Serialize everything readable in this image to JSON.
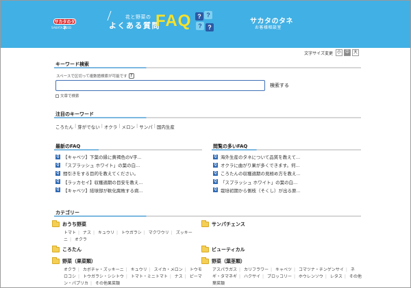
{
  "header": {
    "logo_text": "サカタのタネ",
    "logo_sub": "SAKATA SEED",
    "small_title": "花と野菜の",
    "main_title": "よくある質問",
    "faq": "FAQ",
    "q": "?",
    "brand": "サカタのタネ",
    "brand_sub": "お客様相談室",
    "colors": {
      "header_bg": "#41b0e4",
      "faq": "#f7e22a",
      "accent": "#2f6ab4"
    }
  },
  "font_size": {
    "label": "文字サイズ変更",
    "small": "小",
    "medium": "中",
    "large": "大",
    "selected": "中"
  },
  "search": {
    "title": "キーワード検索",
    "hint": "スペースで区切って複数語検索が可能です",
    "hint_icon": "?",
    "input_value": "",
    "button": "検索する",
    "checkbox_label": "文章で検索"
  },
  "keywords": {
    "title": "注目のキーワード",
    "items": [
      "ころたん",
      "芽がでない",
      "オクラ",
      "メロン",
      "サンパ",
      "国内生産"
    ]
  },
  "latest": {
    "title": "最新のFAQ",
    "items": [
      "【キャベツ】下葉の縁に黄褐色のV字...",
      "「スプラッシュ ホワイト」の葉の白...",
      "間引きをする目的を教えてください。",
      "【ラッカセイ】収穫適期の目安を教え...",
      "【キャベツ】結球部が軟化腐敗する病..."
    ]
  },
  "popular": {
    "title": "閲覧の多いFAQ",
    "items": [
      "海外生産のタネについて品質を教えて...",
      "オクラに曲がり果が多くできます。何...",
      "ころたんの収穫適期の見極め方を教え...",
      "「スプラッシュ ホワイト」の葉の白...",
      "栽培初期から側枝（そくし）が出る原..."
    ]
  },
  "categories": {
    "title": "カテゴリー",
    "left": [
      {
        "name": "おうち野菜",
        "items": [
          "トマト",
          "ナス",
          "キュウリ",
          "トウガラシ",
          "マクワウリ",
          "ズッキーニ",
          "オクラ"
        ]
      },
      {
        "name": "ころたん",
        "items": []
      },
      {
        "name": "野菜（果菜類）",
        "items": [
          "オクラ",
          "カボチャ・ズッキーニ",
          "キュウリ",
          "スイカ・メロン",
          "トウモロコシ",
          "トウガラシ・シシトウ",
          "トマト・ミニトマト",
          "ナス",
          "ピーマン・パプリカ",
          "その他果菜類"
        ]
      }
    ],
    "right": [
      {
        "name": "サンパチェンス",
        "items": []
      },
      {
        "name": "ビューティカル",
        "items": []
      },
      {
        "name": "野菜（葉茎類）",
        "items": [
          "アスパラガス",
          "カリフラワー",
          "キャベツ",
          "コマツナ・チンゲンサイ",
          "ネギ・タマネギ",
          "ハクサイ",
          "ブロッコリー",
          "ホウレンソウ",
          "レタス",
          "その他葉菜類"
        ]
      }
    ]
  }
}
